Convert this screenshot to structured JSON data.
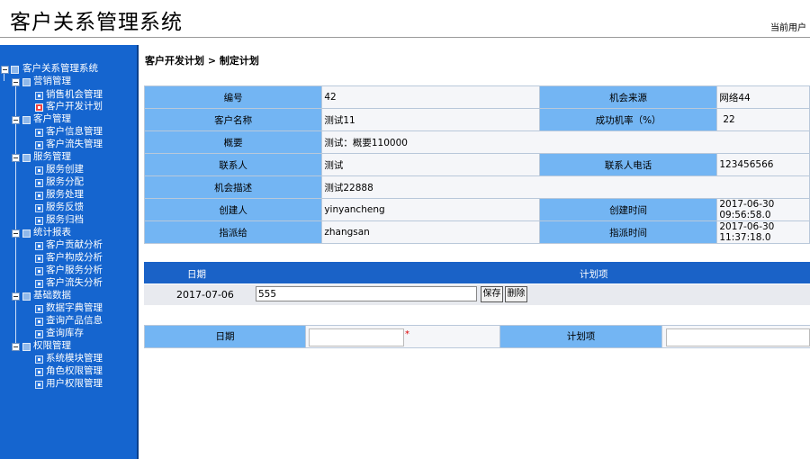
{
  "header": {
    "title": "客户关系管理系统",
    "current_user": "当前用户"
  },
  "sidebar": {
    "root": "客户关系管理系统",
    "groups": [
      {
        "label": "营销管理",
        "items": [
          "销售机会管理",
          "客户开发计划"
        ]
      },
      {
        "label": "客户管理",
        "items": [
          "客户信息管理",
          "客户流失管理"
        ]
      },
      {
        "label": "服务管理",
        "items": [
          "服务创建",
          "服务分配",
          "服务处理",
          "服务反馈",
          "服务归档"
        ]
      },
      {
        "label": "统计报表",
        "items": [
          "客户贡献分析",
          "客户构成分析",
          "客户服务分析",
          "客户流失分析"
        ]
      },
      {
        "label": "基础数据",
        "items": [
          "数据字典管理",
          "查询产品信息",
          "查询库存"
        ]
      },
      {
        "label": "权限管理",
        "items": [
          "系统模块管理",
          "角色权限管理",
          "用户权限管理"
        ]
      }
    ]
  },
  "breadcrumb": "客户开发计划 > 制定计划",
  "detail": {
    "id_label": "编号",
    "id": "42",
    "source_label": "机会来源",
    "source": "网络44",
    "customer_label": "客户名称",
    "customer": "测试11",
    "rate_label": "成功机率（%）",
    "rate": "22",
    "summary_label": "概要",
    "summary": "测试：概要110000",
    "contact_label": "联系人",
    "contact": "测试",
    "phone_label": "联系人电话",
    "phone": "123456566",
    "desc_label": "机会描述",
    "desc": "测试22888",
    "creator_label": "创建人",
    "creator": "yinyancheng",
    "created_label": "创建时间",
    "created": "2017-06-30 09:56:58.0",
    "assignee_label": "指派给",
    "assignee": "zhangsan",
    "assigned_label": "指派时间",
    "assigned": "2017-06-30 11:37:18.0"
  },
  "plan": {
    "head_date": "日期",
    "head_item": "计划项",
    "rows": [
      {
        "date": "2017-07-06",
        "item": "555"
      }
    ],
    "save_label": "保存",
    "delete_label": "删除"
  },
  "new_plan": {
    "date_label": "日期",
    "required_mark": "*",
    "item_label": "计划项",
    "date_value": "",
    "item_value": ""
  }
}
